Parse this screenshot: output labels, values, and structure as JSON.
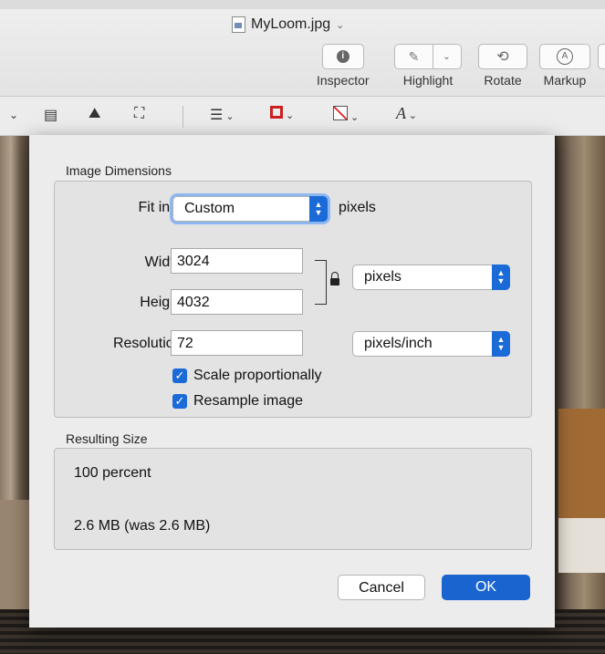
{
  "window": {
    "title": "MyLoom.jpg"
  },
  "toolbar": {
    "inspector_label": "Inspector",
    "highlight_label": "Highlight",
    "rotate_label": "Rotate",
    "markup_label": "Markup"
  },
  "dialog": {
    "image_dimensions_label": "Image Dimensions",
    "fit_into_label": "Fit into:",
    "fit_into_value": "Custom",
    "fit_into_unit": "pixels",
    "width_label": "Width:",
    "width_value": "3024",
    "height_label": "Height:",
    "height_value": "4032",
    "size_unit_value": "pixels",
    "resolution_label": "Resolution:",
    "resolution_value": "72",
    "resolution_unit_value": "pixels/inch",
    "scale_label": "Scale proportionally",
    "scale_checked": true,
    "resample_label": "Resample image",
    "resample_checked": true,
    "resulting_size_label": "Resulting Size",
    "result_percent": "100 percent",
    "result_size": "2.6 MB (was 2.6 MB)",
    "cancel_label": "Cancel",
    "ok_label": "OK"
  },
  "colors": {
    "accent": "#1a6ad8",
    "ok_button": "#1a64d0",
    "dialog_bg": "#ececec"
  }
}
